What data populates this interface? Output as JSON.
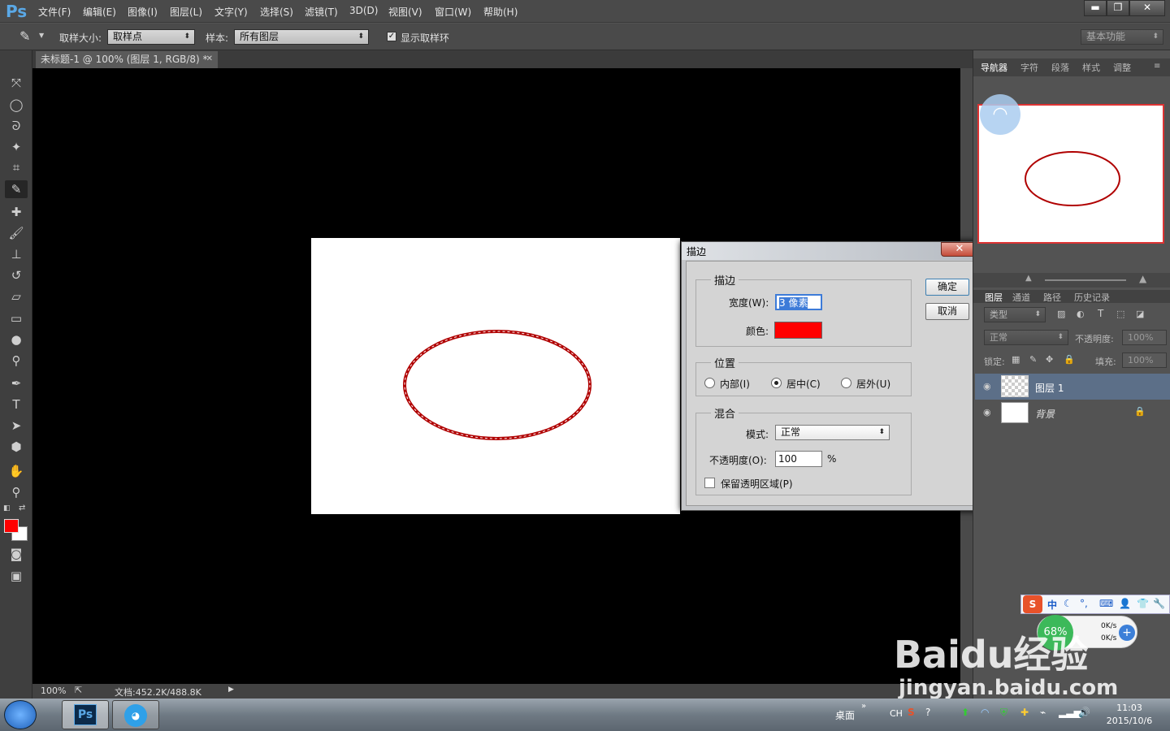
{
  "app": {
    "logo": "Ps"
  },
  "menu": [
    "文件(F)",
    "编辑(E)",
    "图像(I)",
    "图层(L)",
    "文字(Y)",
    "选择(S)",
    "滤镜(T)",
    "3D(D)",
    "视图(V)",
    "窗口(W)",
    "帮助(H)"
  ],
  "window_controls": {
    "minimize": "▬",
    "restore": "❐",
    "close": "✕"
  },
  "options": {
    "sample_size_label": "取样大小:",
    "sample_size_value": "取样点",
    "sample_label": "样本:",
    "sample_value": "所有图层",
    "show_ring_label": "显示取样环",
    "workspace": "基本功能"
  },
  "document": {
    "tab_title": "未标题-1 @ 100% (图层 1, RGB/8) *",
    "zoom": "100%",
    "doc_size": "文档:452.2K/488.8K",
    "ellipse_color": "#b00000"
  },
  "stroke_dialog": {
    "title": "描边",
    "close": "✕",
    "group_stroke": "描边",
    "width_label": "宽度(W):",
    "width_value": "3 像素",
    "color_label": "颜色:",
    "color_value": "#ff0000",
    "group_position": "位置",
    "pos_inside": "内部(I)",
    "pos_center": "居中(C)",
    "pos_outside": "居外(U)",
    "selected_position": "居中(C)",
    "group_blend": "混合",
    "mode_label": "模式:",
    "mode_value": "正常",
    "opacity_label": "不透明度(O):",
    "opacity_value": "100",
    "opacity_unit": "%",
    "preserve_label": "保留透明区域(P)",
    "ok": "确定",
    "cancel": "取消"
  },
  "right_panel": {
    "top_tabs": [
      "导航器",
      "字符",
      "段落",
      "样式",
      "调整"
    ],
    "layer_tabs": [
      "图层",
      "通道",
      "路径",
      "历史记录"
    ],
    "filter_label": "类型",
    "blend_mode": "正常",
    "opacity_label": "不透明度:",
    "opacity_value": "100%",
    "lock_label": "锁定:",
    "fill_label": "填充:",
    "fill_value": "100%",
    "layers": [
      {
        "name": "图层 1",
        "selected": true
      },
      {
        "name": "背景",
        "selected": false
      }
    ]
  },
  "taskbar": {
    "desktop_label": "桌面",
    "ime": "CH",
    "time": "11:03",
    "date": "2015/10/6",
    "net_percent": "68%",
    "up_speed": "0K/s",
    "down_speed": "0K/s",
    "ime_mode": "中"
  },
  "watermark": {
    "brand": "Baidu经验",
    "url": "jingyan.baidu.com"
  }
}
